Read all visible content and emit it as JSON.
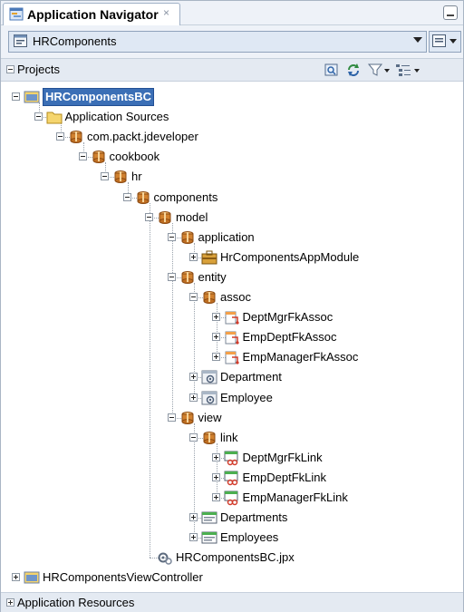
{
  "tab": {
    "title": "Application Navigator",
    "close": "×",
    "icon": "application-navigator-icon"
  },
  "app_selector": {
    "value": "HRComponents"
  },
  "projects_header": {
    "label": "Projects"
  },
  "tree": [
    {
      "label": "HRComponentsBC",
      "depth": 0,
      "expander": "minus",
      "icon": "project-folder-icon",
      "selected": true
    },
    {
      "label": "Application Sources",
      "depth": 1,
      "expander": "minus",
      "icon": "folder-icon"
    },
    {
      "label": "com.packt.jdeveloper",
      "depth": 2,
      "expander": "minus",
      "icon": "package-icon"
    },
    {
      "label": "cookbook",
      "depth": 3,
      "expander": "minus",
      "icon": "package-icon"
    },
    {
      "label": "hr",
      "depth": 4,
      "expander": "minus",
      "icon": "package-icon"
    },
    {
      "label": "components",
      "depth": 5,
      "expander": "minus",
      "icon": "package-icon"
    },
    {
      "label": "model",
      "depth": 6,
      "expander": "minus",
      "icon": "package-icon"
    },
    {
      "label": "application",
      "depth": 7,
      "expander": "minus",
      "icon": "package-icon"
    },
    {
      "label": "HrComponentsAppModule",
      "depth": 8,
      "expander": "plus",
      "icon": "app-module-icon"
    },
    {
      "label": "entity",
      "depth": 7,
      "expander": "minus",
      "icon": "package-icon"
    },
    {
      "label": "assoc",
      "depth": 8,
      "expander": "minus",
      "icon": "package-icon"
    },
    {
      "label": "DeptMgrFkAssoc",
      "depth": 9,
      "expander": "plus",
      "icon": "association-icon"
    },
    {
      "label": "EmpDeptFkAssoc",
      "depth": 9,
      "expander": "plus",
      "icon": "association-icon"
    },
    {
      "label": "EmpManagerFkAssoc",
      "depth": 9,
      "expander": "plus",
      "icon": "association-icon"
    },
    {
      "label": "Department",
      "depth": 8,
      "expander": "plus",
      "icon": "entity-object-icon"
    },
    {
      "label": "Employee",
      "depth": 8,
      "expander": "plus",
      "icon": "entity-object-icon"
    },
    {
      "label": "view",
      "depth": 7,
      "expander": "minus",
      "icon": "package-icon"
    },
    {
      "label": "link",
      "depth": 8,
      "expander": "minus",
      "icon": "package-icon"
    },
    {
      "label": "DeptMgrFkLink",
      "depth": 9,
      "expander": "plus",
      "icon": "view-link-icon"
    },
    {
      "label": "EmpDeptFkLink",
      "depth": 9,
      "expander": "plus",
      "icon": "view-link-icon"
    },
    {
      "label": "EmpManagerFkLink",
      "depth": 9,
      "expander": "plus",
      "icon": "view-link-icon"
    },
    {
      "label": "Departments",
      "depth": 8,
      "expander": "plus",
      "icon": "view-object-icon"
    },
    {
      "label": "Employees",
      "depth": 8,
      "expander": "plus",
      "icon": "view-object-icon"
    },
    {
      "label": "HRComponentsBC.jpx",
      "depth": 6,
      "expander": "none",
      "icon": "jpx-file-icon"
    },
    {
      "label": "HRComponentsViewController",
      "depth": 0,
      "expander": "plus",
      "icon": "project-folder-icon"
    }
  ],
  "bottom_panel": {
    "label": "Application Resources"
  },
  "colors": {
    "selection": "#3b6fb6",
    "panel": "#eef2f8",
    "folder": "#f2c94c",
    "package": "#c8762a"
  }
}
